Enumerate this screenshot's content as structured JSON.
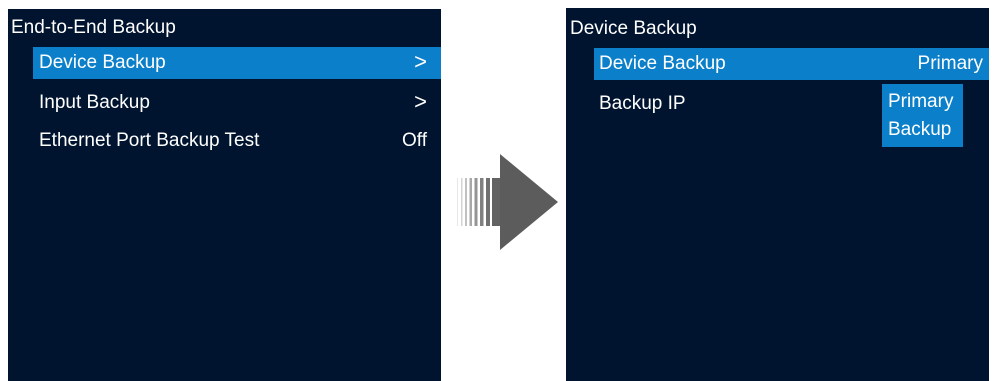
{
  "left_screen": {
    "title": "End-to-End Backup",
    "items": [
      {
        "label": "Device Backup",
        "value": ">",
        "selected": true
      },
      {
        "label": "Input Backup",
        "value": ">",
        "selected": false
      },
      {
        "label": "Ethernet Port Backup Test",
        "value": "Off",
        "selected": false
      }
    ]
  },
  "right_screen": {
    "title": "Device Backup",
    "items": [
      {
        "label": "Device Backup",
        "value": "Primary",
        "selected": true
      },
      {
        "label": "Backup IP",
        "value": "",
        "selected": false
      }
    ],
    "dropdown": {
      "options": [
        "Primary",
        "Backup"
      ]
    }
  },
  "colors": {
    "screen_background": "#00142f",
    "highlight": "#0b7fc9",
    "text": "#ffffff",
    "arrow": "#5c5c5c"
  },
  "icons": {
    "transition_arrow": "right-arrow-icon"
  }
}
